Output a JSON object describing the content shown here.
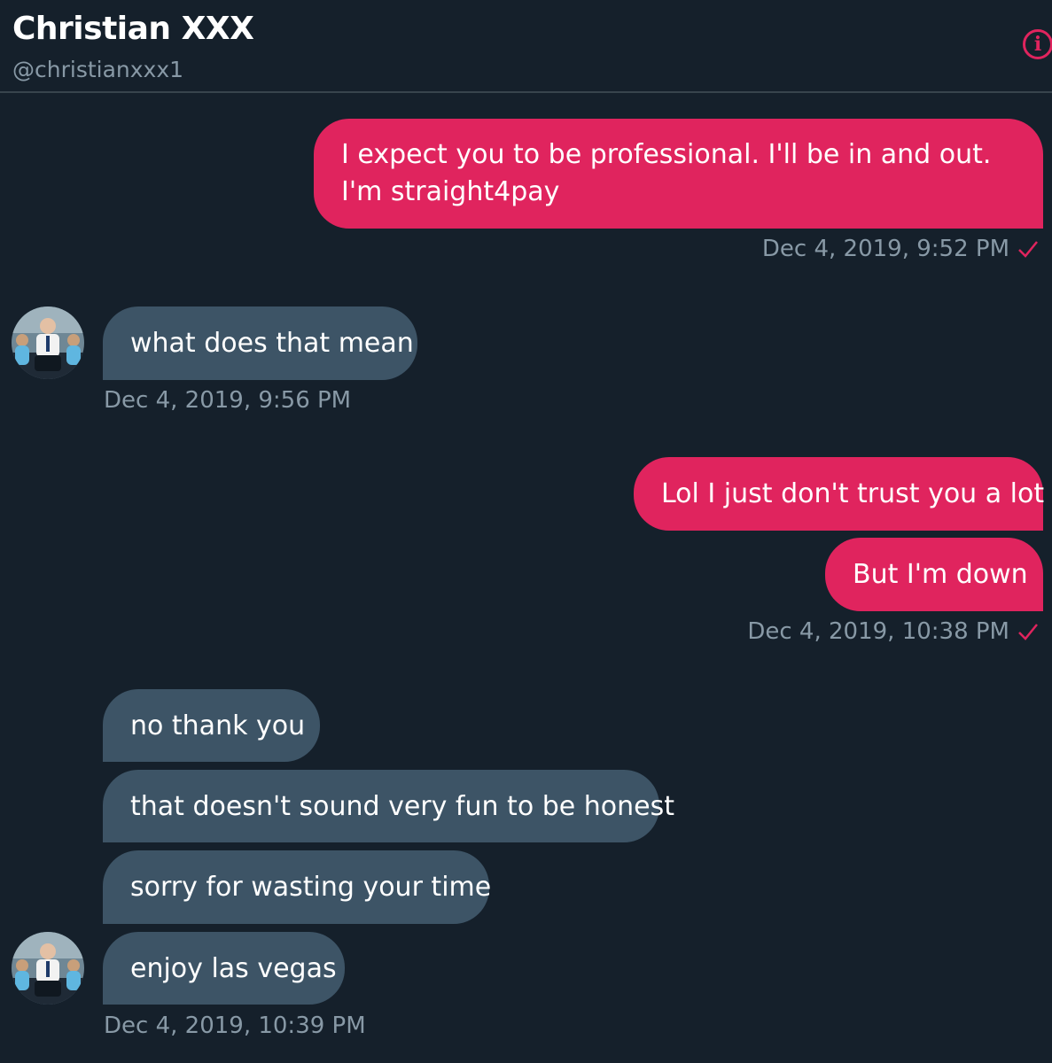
{
  "header": {
    "name": "Christian XXX",
    "handle": "@christianxxx1",
    "info_icon": "info-icon",
    "accent": "#e0245e"
  },
  "messages": [
    {
      "side": "sent",
      "text": "I expect you to be professional. I'll be in and out. I'm straight4pay"
    },
    {
      "side": "sent_time",
      "text": "Dec 4, 2019, 9:52 PM"
    },
    {
      "side": "recv",
      "text": "what does that mean"
    },
    {
      "side": "recv_time",
      "text": "Dec 4, 2019, 9:56 PM"
    },
    {
      "side": "sent",
      "text": "Lol I just don't trust you a lot"
    },
    {
      "side": "sent",
      "text": "But I'm down"
    },
    {
      "side": "sent_time",
      "text": "Dec 4, 2019, 10:38 PM"
    },
    {
      "side": "recv",
      "text": "no thank you"
    },
    {
      "side": "recv",
      "text": "that doesn't sound very fun to be honest"
    },
    {
      "side": "recv",
      "text": "sorry for wasting your time"
    },
    {
      "side": "recv",
      "text": "enjoy las vegas"
    },
    {
      "side": "recv_time",
      "text": "Dec 4, 2019, 10:39 PM"
    }
  ],
  "colors": {
    "background": "#15202b",
    "sent_bubble": "#e0245e",
    "received_bubble": "#3d5466",
    "muted_text": "#8899a6"
  }
}
